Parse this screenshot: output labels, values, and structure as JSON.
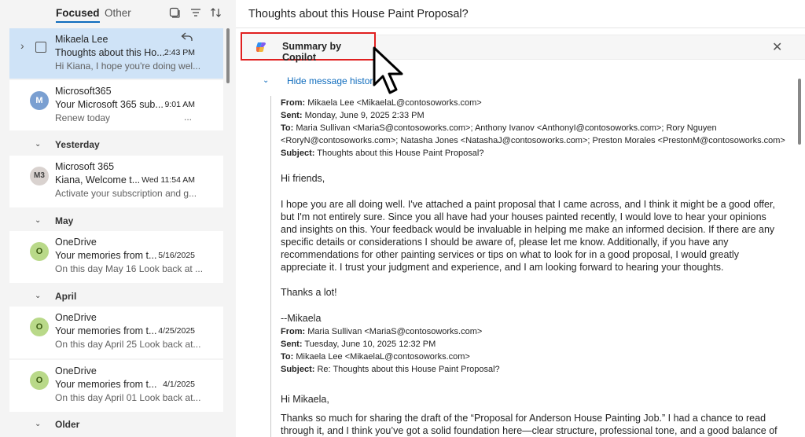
{
  "list": {
    "tabs": {
      "focused": "Focused",
      "other": "Other"
    },
    "groups": {
      "yesterday": "Yesterday",
      "may": "May",
      "april": "April",
      "older": "Older"
    },
    "items": [
      {
        "sender": "Mikaela Lee",
        "subject": "Thoughts about this Ho...",
        "time": "2:43 PM",
        "preview": "Hi Kiana, I hope you're doing wel...",
        "selected": true
      },
      {
        "avatar": "M",
        "sender": "Microsoft365",
        "subject": "Your Microsoft 365 sub...",
        "time": "9:01 AM",
        "preview": "Renew today",
        "more": "..."
      },
      {
        "avatar": "M3",
        "sender": "Microsoft 365",
        "subject": "Kiana, Welcome t...",
        "time": "Wed 11:54 AM",
        "preview": "Activate your subscription and g..."
      },
      {
        "avatar": "O",
        "sender": "OneDrive",
        "subject": "Your memories from t...",
        "time": "5/16/2025",
        "preview": "On this day May 16 Look back at ..."
      },
      {
        "avatar": "O",
        "sender": "OneDrive",
        "subject": "Your memories from t...",
        "time": "4/25/2025",
        "preview": "On this day April 25 Look back at..."
      },
      {
        "avatar": "O",
        "sender": "OneDrive",
        "subject": "Your memories from t...",
        "time": "4/1/2025",
        "preview": "On this day April 01 Look back at..."
      }
    ]
  },
  "reading": {
    "subject": "Thoughts about this House Paint Proposal?",
    "copilot_label": "Summary by Copilot",
    "hide_history": "Hide message history",
    "msg1": {
      "from_label": "From:",
      "from": "Mikaela Lee <MikaelaL@contosoworks.com>",
      "sent_label": "Sent:",
      "sent": "Monday, June 9, 2025 2:33 PM",
      "to_label": "To:",
      "to_line1": "Maria Sullivan <MariaS@contosoworks.com>; Anthony Ivanov <AnthonyI@contosoworks.com>; Rory Nguyen",
      "to_line2": "<RoryN@contosoworks.com>; Natasha Jones <NatashaJ@contosoworks.com>; Preston Morales <PrestonM@contosoworks.com>",
      "subject_label": "Subject:",
      "subject": "Thoughts about this House Paint Proposal?",
      "greeting": "Hi friends,",
      "body_l1": "I hope you are all doing well. I've attached a paint proposal that I came across, and I think it might be a good offer,",
      "body_l2": "but I'm not entirely sure. Since you all have had your houses painted recently, I would love to hear your opinions",
      "body_l3": "and insights on this. Your feedback would be invaluable in helping me make an informed decision. If there are any",
      "body_l4": "specific details or considerations I should be aware of, please let me know. Additionally, if you have any",
      "body_l5": "recommendations for other painting services or tips on what to look for in a good proposal, I would greatly",
      "body_l6": "appreciate it. I trust your judgment and experience, and I am looking forward to hearing your thoughts.",
      "thanks": "Thanks a lot!",
      "signature": "--Mikaela"
    },
    "msg2": {
      "from_label": "From:",
      "from": "Maria Sullivan <MariaS@contosoworks.com>",
      "sent_label": "Sent:",
      "sent": "Tuesday, June 10, 2025 12:32 PM",
      "to_label": "To:",
      "to": "Mikaela Lee <MikaelaL@contosoworks.com>",
      "subject_label": "Subject:",
      "subject": "Re: Thoughts about this House Paint Proposal?",
      "greeting": "Hi Mikaela,",
      "body_l1": "Thanks so much for sharing the draft of the “Proposal for Anderson House Painting Job.” I had a chance to read",
      "body_l2": "through it, and I think you’ve got a solid foundation here—clear structure, professional tone, and a good balance of"
    }
  },
  "colors": {
    "accent": "#0f6cbd",
    "selected_row": "#cfe3f7",
    "highlight_box": "#e02020"
  }
}
